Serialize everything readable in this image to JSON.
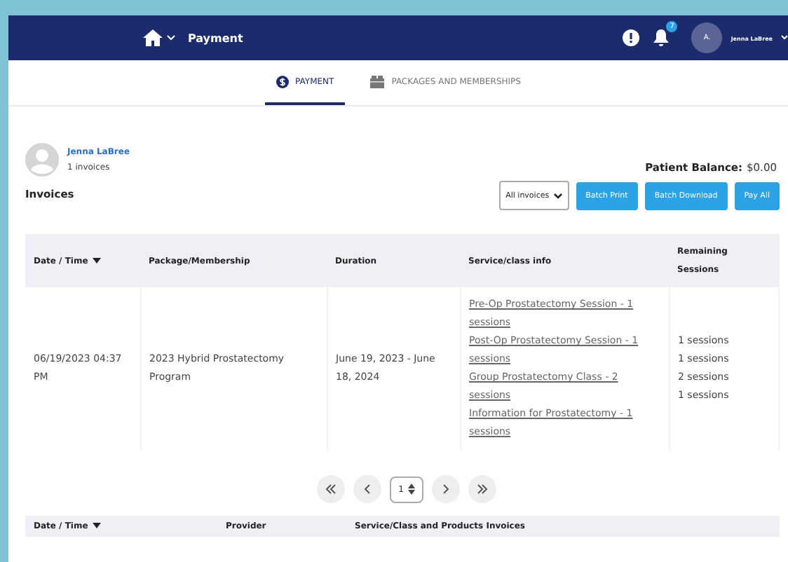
{
  "header": {
    "title": "Payment",
    "notification_count": "7",
    "avatar_initial": "A.",
    "user_name": "Jenna LaBree"
  },
  "tabs": [
    {
      "label": "PAYMENT",
      "selected": true
    },
    {
      "label": "PACKAGES AND MEMBERSHIPS",
      "selected": false
    }
  ],
  "patient": {
    "name": "Jenna LaBree",
    "invoice_count": "1 invoices"
  },
  "balance": {
    "label": "Patient Balance:",
    "value": "$0.00"
  },
  "section_title": "Invoices",
  "filter": {
    "value": "All invoices"
  },
  "buttons": [
    "Batch Print",
    "Batch Download",
    "Pay All"
  ],
  "table": {
    "columns": [
      {
        "label": "Date / Time",
        "sortable": true
      },
      {
        "label": "Package/Membership",
        "sortable": false
      },
      {
        "label": "Duration",
        "sortable": false
      },
      {
        "label": "Service/class info",
        "sortable": false
      },
      {
        "label": "Remaining Sessions",
        "sortable": false
      }
    ],
    "rows": [
      {
        "date": "06/19/2023 04:37 PM",
        "package": "2023 Hybrid Prostatectomy Program",
        "duration": "June 19, 2023 - June 18, 2024",
        "services": [
          "Pre-Op Prostatectomy Session - 1 sessions",
          "Post-Op Prostatectomy Session - 1 sessions",
          "Group Prostatectomy Class - 2 sessions",
          "Information for Prostatectomy - 1 sessions"
        ],
        "remaining": [
          "1 sessions",
          "1 sessions",
          "2 sessions",
          "1 sessions"
        ]
      }
    ]
  },
  "pagination": {
    "page": "1"
  },
  "invoices_table": {
    "columns": [
      {
        "label": "Date / Time",
        "sortable": true
      },
      {
        "label": "Provider",
        "sortable": false
      },
      {
        "label": "Service/Class and Products Invoices",
        "sortable": false
      }
    ]
  }
}
